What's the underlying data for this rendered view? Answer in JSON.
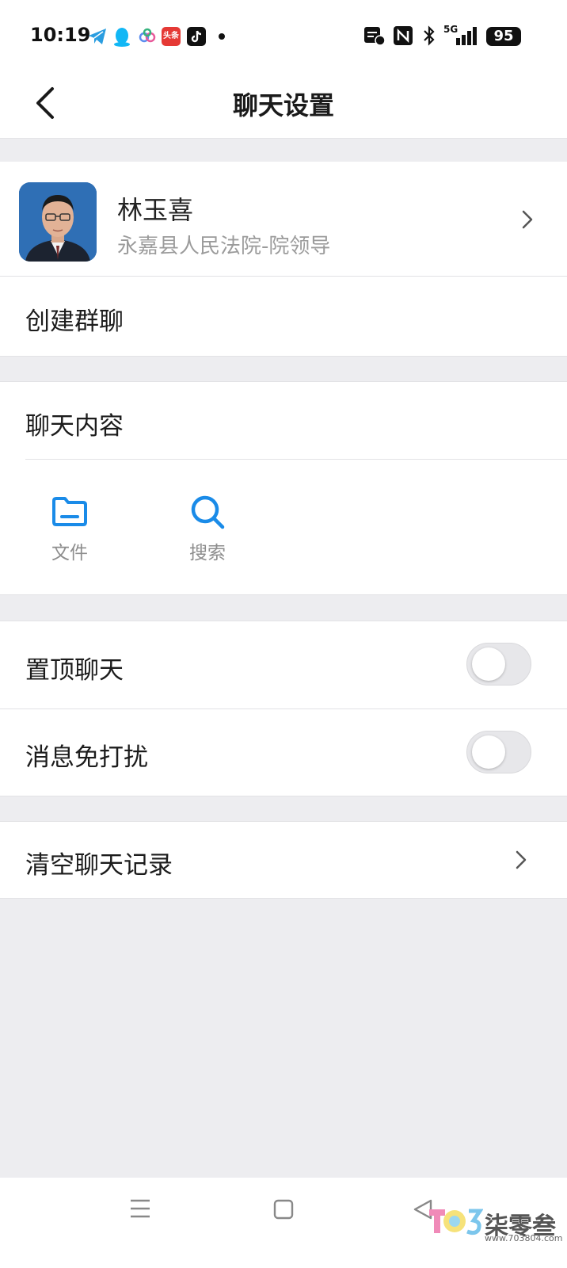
{
  "status_bar": {
    "time": "10:19",
    "signal": "5G",
    "battery": "95"
  },
  "header": {
    "title": "聊天设置",
    "back_icon": "chevron-left-icon"
  },
  "contact": {
    "name": "林玉喜",
    "subtitle": "永嘉县人民法院-院领导"
  },
  "create_group": {
    "label": "创建群聊"
  },
  "chat_content": {
    "label": "聊天内容",
    "items": [
      {
        "label": "文件",
        "icon": "folder-icon"
      },
      {
        "label": "搜索",
        "icon": "search-icon"
      }
    ]
  },
  "settings": {
    "pin_chat": {
      "label": "置顶聊天",
      "enabled": false
    },
    "do_not_disturb": {
      "label": "消息免打扰",
      "enabled": false
    }
  },
  "clear_history": {
    "label": "清空聊天记录"
  },
  "watermark": {
    "text": "柒零叁",
    "small": "www.703804.com"
  },
  "colors": {
    "accent": "#1a8be8",
    "background": "#ededf0",
    "toggle_off": "#e7e7ea"
  }
}
